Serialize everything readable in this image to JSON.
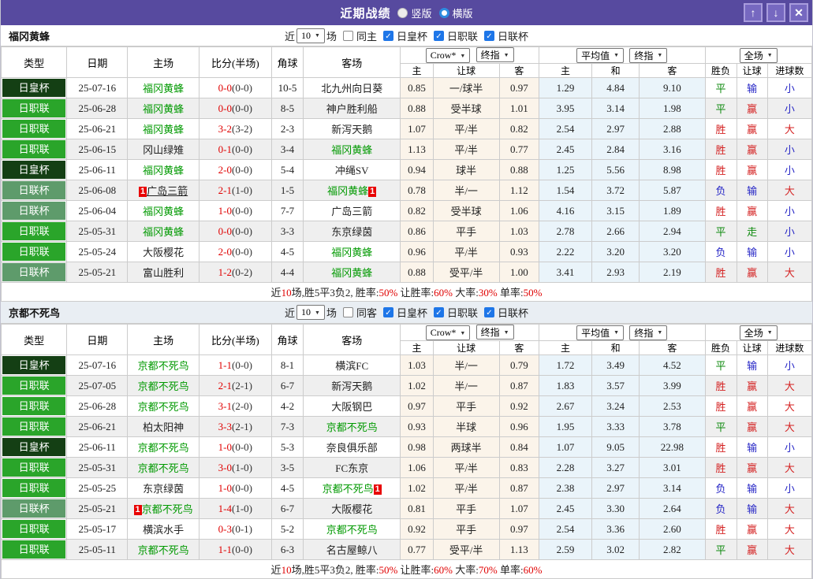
{
  "colors": {
    "titlebar_bg": "#574a9f",
    "window_button_bg": "#7668c0",
    "royal_cup_bg": "#143f14",
    "j1_league_bg": "#2aa52a",
    "league_cup_bg": "#5e9b6b",
    "team_link_green": "#009900",
    "score_red": "#e00000",
    "win_red": "#d42222",
    "lose_blue": "#2626c6",
    "draw_green": "#0e8a0e",
    "crow_col_bg": "#fbf4ea",
    "avg_col_bg": "#eaf4fa",
    "checkbox_blue": "#1e76e8"
  },
  "titlebar": {
    "title": "近期战绩",
    "radio_vertical": "竖版",
    "radio_horizontal": "横版",
    "up_button": "↑",
    "down_button": "↓",
    "close_button": "✕"
  },
  "table_header": {
    "cols": [
      "类型",
      "日期",
      "主场",
      "比分(半场)",
      "角球",
      "客场"
    ],
    "selects": {
      "crow": "Crow*",
      "final1": "终指",
      "avg": "平均值",
      "final2": "终指",
      "full": "全场"
    },
    "sub": [
      "主",
      "让球",
      "客",
      "主",
      "和",
      "客",
      "胜负",
      "让球",
      "进球数"
    ]
  },
  "sections": [
    {
      "team": "福冈黄蜂",
      "filter": {
        "near": "近",
        "count": "10",
        "games": "场",
        "same": "同主",
        "cups": [
          "日皇杯",
          "日职联",
          "日联杯"
        ]
      },
      "rows": [
        {
          "type": "日皇杯",
          "tc": "royal",
          "date": "25-07-16",
          "home": {
            "n": "福冈黄蜂",
            "g": 1
          },
          "score": [
            "0-0",
            "(0-0)"
          ],
          "corner": "10-5",
          "away": {
            "n": "北九州向日葵"
          },
          "crow": [
            "0.85",
            "一/球半",
            "0.97"
          ],
          "avg": [
            "1.29",
            "4.84",
            "9.10"
          ],
          "res": [
            [
              "平",
              "g"
            ],
            [
              "输",
              "b"
            ],
            [
              "小",
              "b"
            ]
          ]
        },
        {
          "type": "日职联",
          "tc": "j1",
          "date": "25-06-28",
          "home": {
            "n": "福冈黄蜂",
            "g": 1
          },
          "score": [
            "0-0",
            "(0-0)"
          ],
          "corner": "8-5",
          "away": {
            "n": "神户胜利船"
          },
          "crow": [
            "0.88",
            "受半球",
            "1.01"
          ],
          "avg": [
            "3.95",
            "3.14",
            "1.98"
          ],
          "res": [
            [
              "平",
              "g"
            ],
            [
              "赢",
              "r"
            ],
            [
              "小",
              "b"
            ]
          ]
        },
        {
          "type": "日职联",
          "tc": "j1",
          "date": "25-06-21",
          "home": {
            "n": "福冈黄蜂",
            "g": 1
          },
          "score": [
            "3-2",
            "(3-2)"
          ],
          "corner": "2-3",
          "away": {
            "n": "新泻天鹅"
          },
          "crow": [
            "1.07",
            "平/半",
            "0.82"
          ],
          "avg": [
            "2.54",
            "2.97",
            "2.88"
          ],
          "res": [
            [
              "胜",
              "r"
            ],
            [
              "赢",
              "r"
            ],
            [
              "大",
              "r"
            ]
          ]
        },
        {
          "type": "日职联",
          "tc": "j1",
          "date": "25-06-15",
          "home": {
            "n": "冈山绿雉"
          },
          "score": [
            "0-1",
            "(0-0)"
          ],
          "corner": "3-4",
          "away": {
            "n": "福冈黄蜂",
            "g": 1
          },
          "crow": [
            "1.13",
            "平/半",
            "0.77"
          ],
          "avg": [
            "2.45",
            "2.84",
            "3.16"
          ],
          "res": [
            [
              "胜",
              "r"
            ],
            [
              "赢",
              "r"
            ],
            [
              "小",
              "b"
            ]
          ]
        },
        {
          "type": "日皇杯",
          "tc": "royal",
          "date": "25-06-11",
          "home": {
            "n": "福冈黄蜂",
            "g": 1
          },
          "score": [
            "2-0",
            "(0-0)"
          ],
          "corner": "5-4",
          "away": {
            "n": "冲绳SV"
          },
          "crow": [
            "0.94",
            "球半",
            "0.88"
          ],
          "avg": [
            "1.25",
            "5.56",
            "8.98"
          ],
          "res": [
            [
              "胜",
              "r"
            ],
            [
              "赢",
              "r"
            ],
            [
              "小",
              "b"
            ]
          ]
        },
        {
          "type": "日联杯",
          "tc": "lcup",
          "date": "25-06-08",
          "home": {
            "n": "广岛三箭",
            "b1": 1,
            "u": 1
          },
          "score": [
            "2-1",
            "(1-0)"
          ],
          "corner": "1-5",
          "away": {
            "n": "福冈黄蜂",
            "g": 1,
            "b2": 1
          },
          "crow": [
            "0.78",
            "半/一",
            "1.12"
          ],
          "avg": [
            "1.54",
            "3.72",
            "5.87"
          ],
          "res": [
            [
              "负",
              "b"
            ],
            [
              "输",
              "b"
            ],
            [
              "大",
              "r"
            ]
          ]
        },
        {
          "type": "日联杯",
          "tc": "lcup",
          "date": "25-06-04",
          "home": {
            "n": "福冈黄蜂",
            "g": 1
          },
          "score": [
            "1-0",
            "(0-0)"
          ],
          "corner": "7-7",
          "away": {
            "n": "广岛三箭"
          },
          "crow": [
            "0.82",
            "受半球",
            "1.06"
          ],
          "avg": [
            "4.16",
            "3.15",
            "1.89"
          ],
          "res": [
            [
              "胜",
              "r"
            ],
            [
              "赢",
              "r"
            ],
            [
              "小",
              "b"
            ]
          ]
        },
        {
          "type": "日职联",
          "tc": "j1",
          "date": "25-05-31",
          "home": {
            "n": "福冈黄蜂",
            "g": 1
          },
          "score": [
            "0-0",
            "(0-0)"
          ],
          "corner": "3-3",
          "away": {
            "n": "东京绿茵"
          },
          "crow": [
            "0.86",
            "平手",
            "1.03"
          ],
          "avg": [
            "2.78",
            "2.66",
            "2.94"
          ],
          "res": [
            [
              "平",
              "g"
            ],
            [
              "走",
              "g"
            ],
            [
              "小",
              "b"
            ]
          ]
        },
        {
          "type": "日职联",
          "tc": "j1",
          "date": "25-05-24",
          "home": {
            "n": "大阪樱花"
          },
          "score": [
            "2-0",
            "(0-0)"
          ],
          "corner": "4-5",
          "away": {
            "n": "福冈黄蜂",
            "g": 1
          },
          "crow": [
            "0.96",
            "平/半",
            "0.93"
          ],
          "avg": [
            "2.22",
            "3.20",
            "3.20"
          ],
          "res": [
            [
              "负",
              "b"
            ],
            [
              "输",
              "b"
            ],
            [
              "小",
              "b"
            ]
          ]
        },
        {
          "type": "日联杯",
          "tc": "lcup",
          "date": "25-05-21",
          "home": {
            "n": "富山胜利"
          },
          "score": [
            "1-2",
            "(0-2)"
          ],
          "corner": "4-4",
          "away": {
            "n": "福冈黄蜂",
            "g": 1
          },
          "crow": [
            "0.88",
            "受平/半",
            "1.00"
          ],
          "avg": [
            "3.41",
            "2.93",
            "2.19"
          ],
          "res": [
            [
              "胜",
              "r"
            ],
            [
              "赢",
              "r"
            ],
            [
              "大",
              "r"
            ]
          ]
        }
      ],
      "summary": [
        [
          "近",
          0
        ],
        [
          "10",
          1
        ],
        [
          "场,胜5平3负2, 胜率:",
          0
        ],
        [
          "50%",
          1
        ],
        [
          " 让胜率:",
          0
        ],
        [
          "60%",
          1
        ],
        [
          " 大率:",
          0
        ],
        [
          "30%",
          1
        ],
        [
          " 单率:",
          0
        ],
        [
          "50%",
          1
        ]
      ]
    },
    {
      "team": "京都不死鸟",
      "filter": {
        "near": "近",
        "count": "10",
        "games": "场",
        "same": "同客",
        "cups": [
          "日皇杯",
          "日职联",
          "日联杯"
        ]
      },
      "rows": [
        {
          "type": "日皇杯",
          "tc": "royal",
          "date": "25-07-16",
          "home": {
            "n": "京都不死鸟",
            "g": 1
          },
          "score": [
            "1-1",
            "(0-0)"
          ],
          "corner": "8-1",
          "away": {
            "n": "横滨FC"
          },
          "crow": [
            "1.03",
            "半/一",
            "0.79"
          ],
          "avg": [
            "1.72",
            "3.49",
            "4.52"
          ],
          "res": [
            [
              "平",
              "g"
            ],
            [
              "输",
              "b"
            ],
            [
              "小",
              "b"
            ]
          ]
        },
        {
          "type": "日职联",
          "tc": "j1",
          "date": "25-07-05",
          "home": {
            "n": "京都不死鸟",
            "g": 1
          },
          "score": [
            "2-1",
            "(2-1)"
          ],
          "corner": "6-7",
          "away": {
            "n": "新泻天鹅"
          },
          "crow": [
            "1.02",
            "半/一",
            "0.87"
          ],
          "avg": [
            "1.83",
            "3.57",
            "3.99"
          ],
          "res": [
            [
              "胜",
              "r"
            ],
            [
              "赢",
              "r"
            ],
            [
              "大",
              "r"
            ]
          ]
        },
        {
          "type": "日职联",
          "tc": "j1",
          "date": "25-06-28",
          "home": {
            "n": "京都不死鸟",
            "g": 1
          },
          "score": [
            "3-1",
            "(2-0)"
          ],
          "corner": "4-2",
          "away": {
            "n": "大阪钢巴"
          },
          "crow": [
            "0.97",
            "平手",
            "0.92"
          ],
          "avg": [
            "2.67",
            "3.24",
            "2.53"
          ],
          "res": [
            [
              "胜",
              "r"
            ],
            [
              "赢",
              "r"
            ],
            [
              "大",
              "r"
            ]
          ]
        },
        {
          "type": "日职联",
          "tc": "j1",
          "date": "25-06-21",
          "home": {
            "n": "柏太阳神"
          },
          "score": [
            "3-3",
            "(2-1)"
          ],
          "corner": "7-3",
          "away": {
            "n": "京都不死鸟",
            "g": 1
          },
          "crow": [
            "0.93",
            "半球",
            "0.96"
          ],
          "avg": [
            "1.95",
            "3.33",
            "3.78"
          ],
          "res": [
            [
              "平",
              "g"
            ],
            [
              "赢",
              "r"
            ],
            [
              "大",
              "r"
            ]
          ]
        },
        {
          "type": "日皇杯",
          "tc": "royal",
          "date": "25-06-11",
          "home": {
            "n": "京都不死鸟",
            "g": 1
          },
          "score": [
            "1-0",
            "(0-0)"
          ],
          "corner": "5-3",
          "away": {
            "n": "奈良俱乐部"
          },
          "crow": [
            "0.98",
            "两球半",
            "0.84"
          ],
          "avg": [
            "1.07",
            "9.05",
            "22.98"
          ],
          "res": [
            [
              "胜",
              "r"
            ],
            [
              "输",
              "b"
            ],
            [
              "小",
              "b"
            ]
          ]
        },
        {
          "type": "日职联",
          "tc": "j1",
          "date": "25-05-31",
          "home": {
            "n": "京都不死鸟",
            "g": 1
          },
          "score": [
            "3-0",
            "(1-0)"
          ],
          "corner": "3-5",
          "away": {
            "n": "FC东京"
          },
          "crow": [
            "1.06",
            "平/半",
            "0.83"
          ],
          "avg": [
            "2.28",
            "3.27",
            "3.01"
          ],
          "res": [
            [
              "胜",
              "r"
            ],
            [
              "赢",
              "r"
            ],
            [
              "大",
              "r"
            ]
          ]
        },
        {
          "type": "日职联",
          "tc": "j1",
          "date": "25-05-25",
          "home": {
            "n": "东京绿茵"
          },
          "score": [
            "1-0",
            "(0-0)"
          ],
          "corner": "4-5",
          "away": {
            "n": "京都不死鸟",
            "g": 1,
            "b2": 1
          },
          "crow": [
            "1.02",
            "平/半",
            "0.87"
          ],
          "avg": [
            "2.38",
            "2.97",
            "3.14"
          ],
          "res": [
            [
              "负",
              "b"
            ],
            [
              "输",
              "b"
            ],
            [
              "小",
              "b"
            ]
          ]
        },
        {
          "type": "日联杯",
          "tc": "lcup",
          "date": "25-05-21",
          "home": {
            "n": "京都不死鸟",
            "g": 1,
            "b1": 1
          },
          "score": [
            "1-4",
            "(1-0)"
          ],
          "corner": "6-7",
          "away": {
            "n": "大阪樱花"
          },
          "crow": [
            "0.81",
            "平手",
            "1.07"
          ],
          "avg": [
            "2.45",
            "3.30",
            "2.64"
          ],
          "res": [
            [
              "负",
              "b"
            ],
            [
              "输",
              "b"
            ],
            [
              "大",
              "r"
            ]
          ]
        },
        {
          "type": "日职联",
          "tc": "j1",
          "date": "25-05-17",
          "home": {
            "n": "横滨水手"
          },
          "score": [
            "0-3",
            "(0-1)"
          ],
          "corner": "5-2",
          "away": {
            "n": "京都不死鸟",
            "g": 1
          },
          "crow": [
            "0.92",
            "平手",
            "0.97"
          ],
          "avg": [
            "2.54",
            "3.36",
            "2.60"
          ],
          "res": [
            [
              "胜",
              "r"
            ],
            [
              "赢",
              "r"
            ],
            [
              "大",
              "r"
            ]
          ]
        },
        {
          "type": "日职联",
          "tc": "j1",
          "date": "25-05-11",
          "home": {
            "n": "京都不死鸟",
            "g": 1
          },
          "score": [
            "1-1",
            "(0-0)"
          ],
          "corner": "6-3",
          "away": {
            "n": "名古屋鲸八"
          },
          "crow": [
            "0.77",
            "受平/半",
            "1.13"
          ],
          "avg": [
            "2.59",
            "3.02",
            "2.82"
          ],
          "res": [
            [
              "平",
              "g"
            ],
            [
              "赢",
              "r"
            ],
            [
              "大",
              "r"
            ]
          ]
        }
      ],
      "summary": [
        [
          "近",
          0
        ],
        [
          "10",
          1
        ],
        [
          "场,胜5平3负2, 胜率:",
          0
        ],
        [
          "50%",
          1
        ],
        [
          " 让胜率:",
          0
        ],
        [
          "60%",
          1
        ],
        [
          " 大率:",
          0
        ],
        [
          "70%",
          1
        ],
        [
          " 单率:",
          0
        ],
        [
          "60%",
          1
        ]
      ]
    }
  ]
}
